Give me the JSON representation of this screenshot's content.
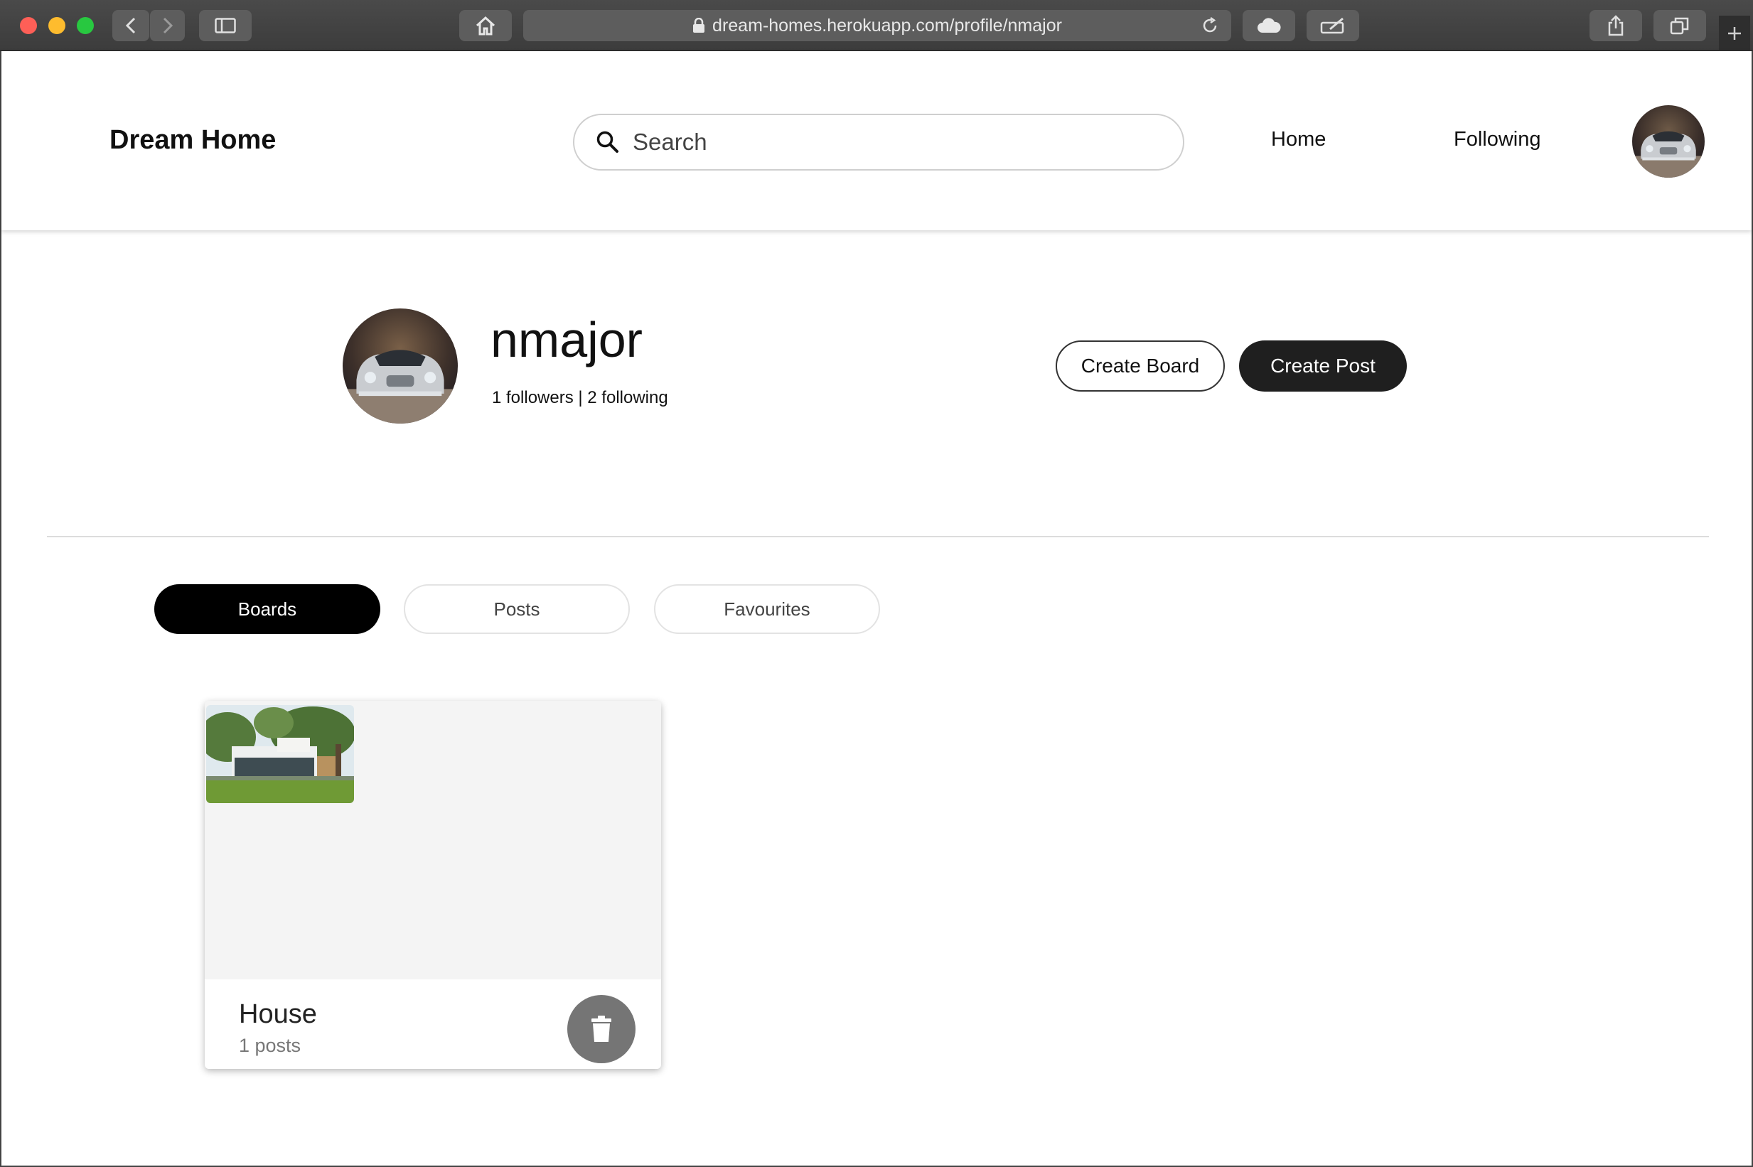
{
  "browser": {
    "url": "dream-homes.herokuapp.com/profile/nmajor"
  },
  "navbar": {
    "brand": "Dream Home",
    "search_placeholder": "Search",
    "links": [
      "Home",
      "Following"
    ]
  },
  "profile": {
    "username": "nmajor",
    "stats": "1 followers | 2 following",
    "create_board_label": "Create Board",
    "create_post_label": "Create Post"
  },
  "tabs": [
    {
      "label": "Boards",
      "active": true
    },
    {
      "label": "Posts",
      "active": false
    },
    {
      "label": "Favourites",
      "active": false
    }
  ],
  "boards": [
    {
      "title": "House",
      "count": "1 posts"
    }
  ],
  "colors": {
    "primary_dark": "#1f1f1f",
    "active_tab": "#000000",
    "delete_button": "#757575"
  }
}
